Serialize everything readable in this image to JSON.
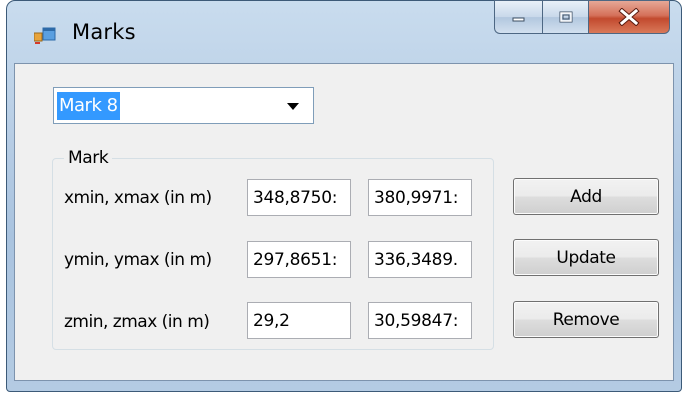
{
  "window": {
    "title": "Marks"
  },
  "combo": {
    "selected": "Mark 8"
  },
  "group": {
    "label": "Mark",
    "rows": [
      {
        "label": "xmin, xmax (in m)",
        "min": "348,8750:",
        "max": "380,9971:"
      },
      {
        "label": "ymin, ymax (in m)",
        "min": "297,8651:",
        "max": "336,3489."
      },
      {
        "label": "zmin, zmax (in m)",
        "min": "29,2",
        "max": "30,59847:"
      }
    ]
  },
  "buttons": {
    "add": "Add",
    "update": "Update",
    "remove": "Remove"
  },
  "colors": {
    "selection": "#3399ff",
    "close_button": "#c24a2e",
    "client_background": "#f0f0f0"
  }
}
